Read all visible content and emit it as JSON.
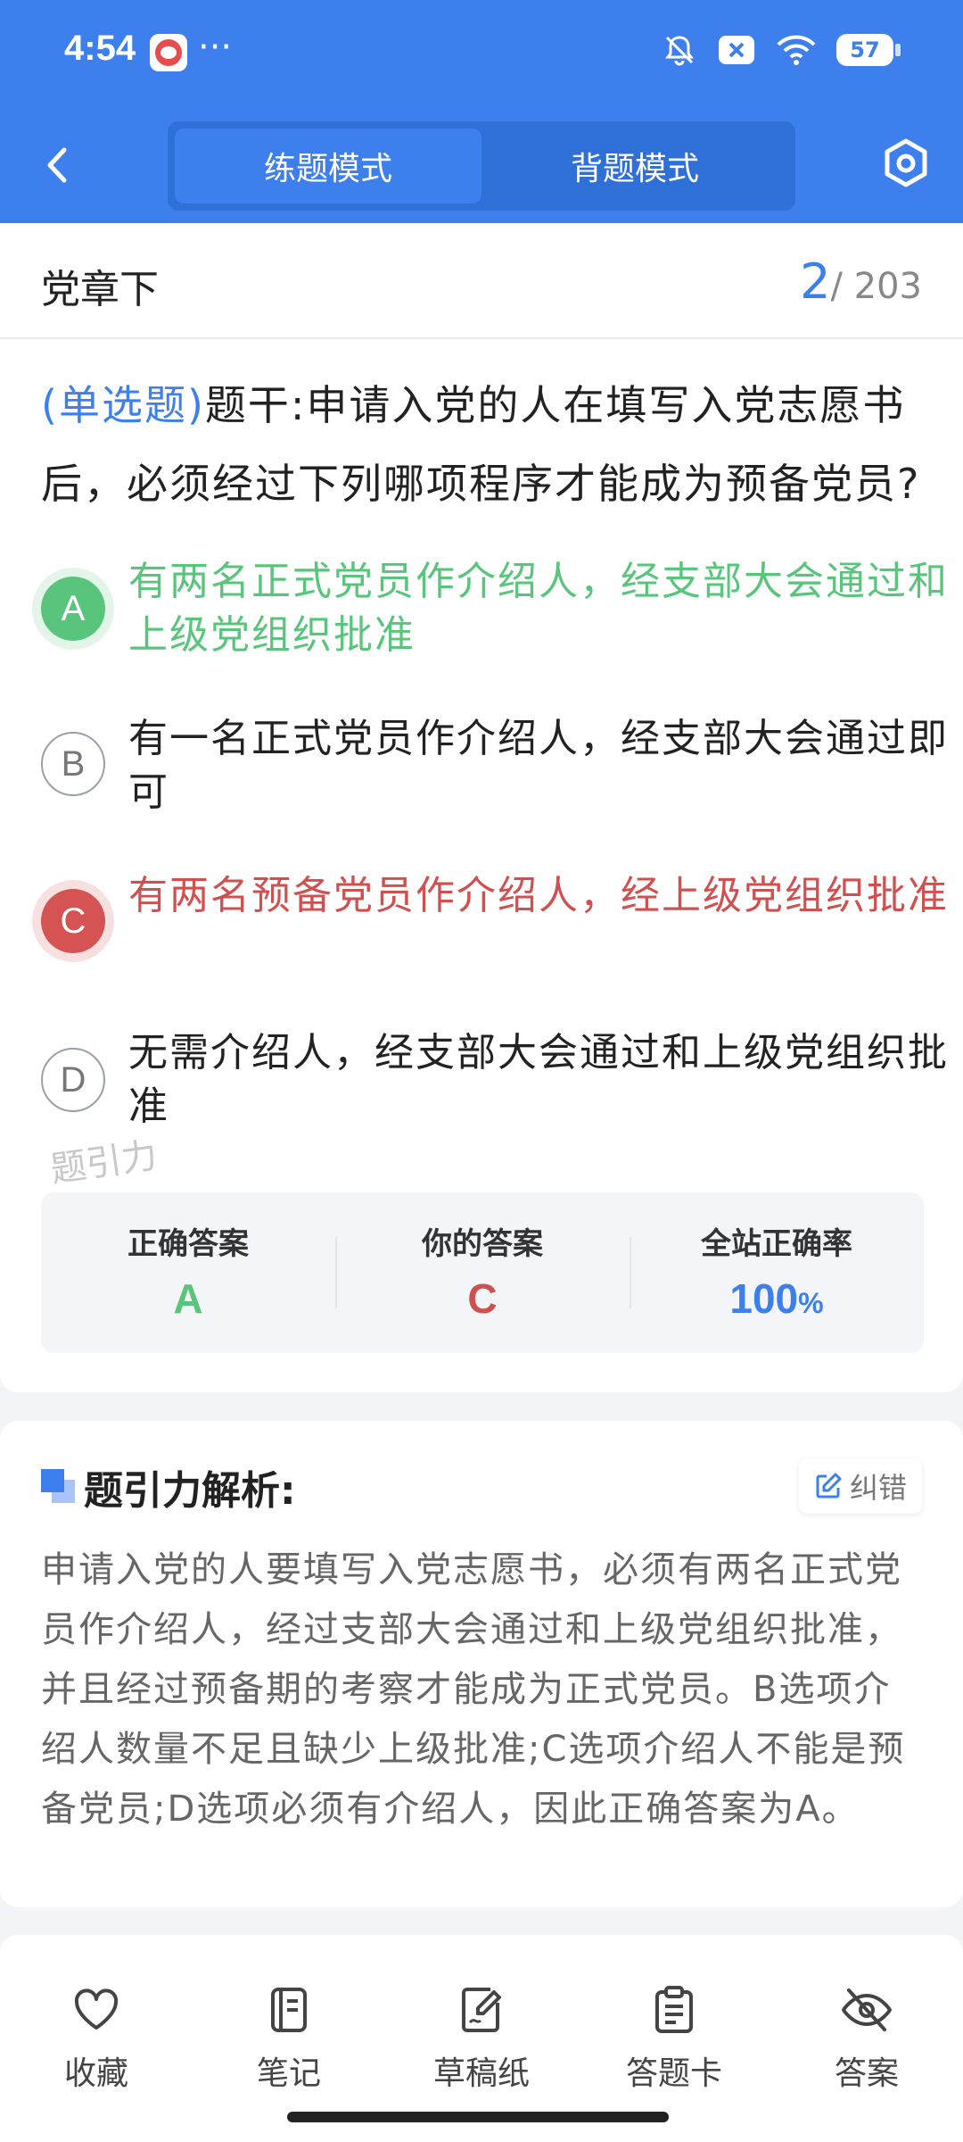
{
  "status_bar": {
    "time": "4:54",
    "dots": "···",
    "battery": "57"
  },
  "nav": {
    "tabs": [
      "练题模式",
      "背题模式"
    ],
    "active_tab": 0
  },
  "title_bar": {
    "section": "党章下",
    "current": "2",
    "total": "/ 203"
  },
  "question": {
    "type_label": "(单选题)",
    "stem": "题干:申请入党的人在填写入党志愿书后，必须经过下列哪项程序才能成为预备党员?",
    "options": [
      {
        "letter": "A",
        "text": "有两名正式党员作介绍人，经支部大会通过和上级党组织批准",
        "state": "correct"
      },
      {
        "letter": "B",
        "text": "有一名正式党员作介绍人，经支部大会通过即可",
        "state": "normal"
      },
      {
        "letter": "C",
        "text": "有两名预备党员作介绍人，经上级党组织批准",
        "state": "wrong"
      },
      {
        "letter": "D",
        "text": "无需介绍人，经支部大会通过和上级党组织批准",
        "state": "normal"
      }
    ],
    "watermark": "题引力"
  },
  "result": {
    "correct_label": "正确答案",
    "correct_value": "A",
    "yours_label": "你的答案",
    "yours_value": "C",
    "rate_label": "全站正确率",
    "rate_value": "100",
    "rate_unit": "%"
  },
  "analysis": {
    "title": "题引力解析:",
    "report_button": "纠错",
    "text": "申请入党的人要填写入党志愿书，必须有两名正式党员作介绍人，经过支部大会通过和上级党组织批准，并且经过预备期的考察才能成为正式党员。B选项介绍人数量不足且缺少上级批准;C选项介绍人不能是预备党员;D选项必须有介绍人，因此正确答案为A。"
  },
  "bottom_bar": {
    "favorite": "收藏",
    "notes": "笔记",
    "scratch": "草稿纸",
    "answer_card": "答题卡",
    "answer": "答案"
  },
  "colors": {
    "primary": "#3d7fed",
    "correct": "#59c57c",
    "wrong": "#d65353"
  }
}
